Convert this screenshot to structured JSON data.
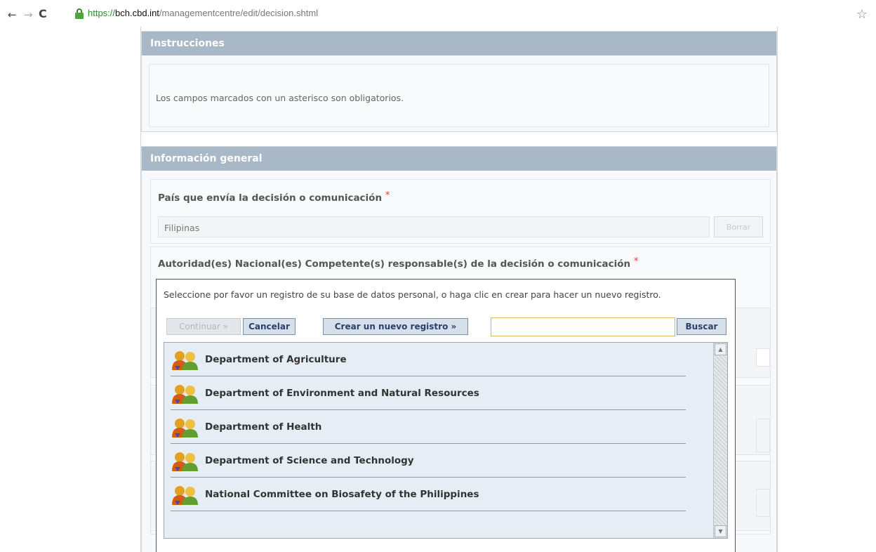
{
  "browser": {
    "url_scheme": "https://",
    "url_host": "bch.cbd.int",
    "url_path": "/managementcentre/edit/decision.shtml"
  },
  "instructions": {
    "header": "Instrucciones",
    "text": "Los campos marcados con un asterisco son obligatorios."
  },
  "general": {
    "header": "Información general",
    "country_label": "País que envía la decisión o comunicación",
    "required_mark": "*",
    "country_value": "Filipinas",
    "clear_label": "Borrar",
    "authority_label": "Autoridad(es) Nacional(es) Competente(s) responsable(s) de la decisión o comunicación"
  },
  "popup": {
    "message": "Seleccione por favor un registro de su base de datos personal, o haga clic en crear para hacer un nuevo registro.",
    "continue_label": "Continuar »",
    "cancel_label": "Cancelar",
    "create_label": "Crear un nuevo registro »",
    "search_value": "",
    "search_label": "Buscar",
    "items": [
      {
        "label": "Department of Agriculture",
        "icon": "people-icon"
      },
      {
        "label": "Department of Environment and Natural Resources",
        "icon": "people-icon"
      },
      {
        "label": "Department of Health",
        "icon": "people-icon"
      },
      {
        "label": "Department of Science and Technology",
        "icon": "people-icon"
      },
      {
        "label": "National Committee on Biosafety of the Philippines",
        "icon": "people-icon"
      }
    ]
  },
  "colors": {
    "panel_header": "#a9b8c7",
    "button_text": "#2b3f6f",
    "required": "#e04040",
    "list_bg": "#e6edf4"
  }
}
